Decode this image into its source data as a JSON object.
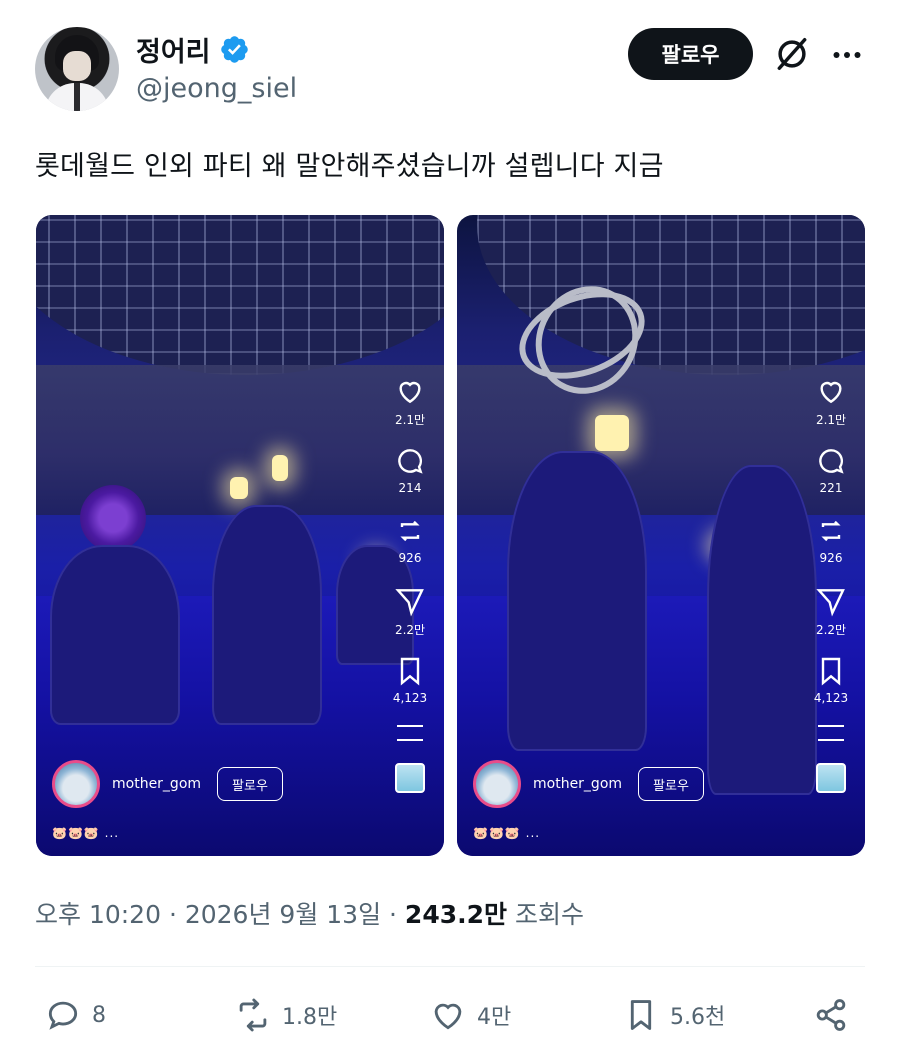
{
  "author": {
    "display_name": "정어리",
    "handle": "@jeong_siel",
    "verified": true,
    "follow_label": "팔로우"
  },
  "icons": {
    "verified": "verified-badge-icon",
    "grok": "grok-icon",
    "more": "more-options-icon"
  },
  "tweet": {
    "text": "롯데월드 인외 파티 왜 말안해주셨습니까 설렙니다 지금"
  },
  "media": [
    {
      "username": "mother_gom",
      "follow_label": "팔로우",
      "emoji_line": "🐷🐷🐷 ...",
      "likes": "2.1만",
      "comments": "214",
      "reposts": "926",
      "shares": "2.2만",
      "saves": "4,123"
    },
    {
      "username": "mother_gom",
      "follow_label": "팔로우",
      "emoji_line": "🐷🐷🐷 ...",
      "likes": "2.1만",
      "comments": "221",
      "reposts": "926",
      "shares": "2.2만",
      "saves": "4,123"
    }
  ],
  "meta": {
    "time": "오후 10:20",
    "separator": " · ",
    "date": "2026년 9월 13일",
    "views_count": "243.2만",
    "views_label": "조회수"
  },
  "actions": {
    "replies": "8",
    "reposts": "1.8만",
    "likes": "4만",
    "bookmarks": "5.6천"
  },
  "colors": {
    "text_primary": "#0f1419",
    "text_secondary": "#536471",
    "verified_blue": "#1d9bf0"
  }
}
